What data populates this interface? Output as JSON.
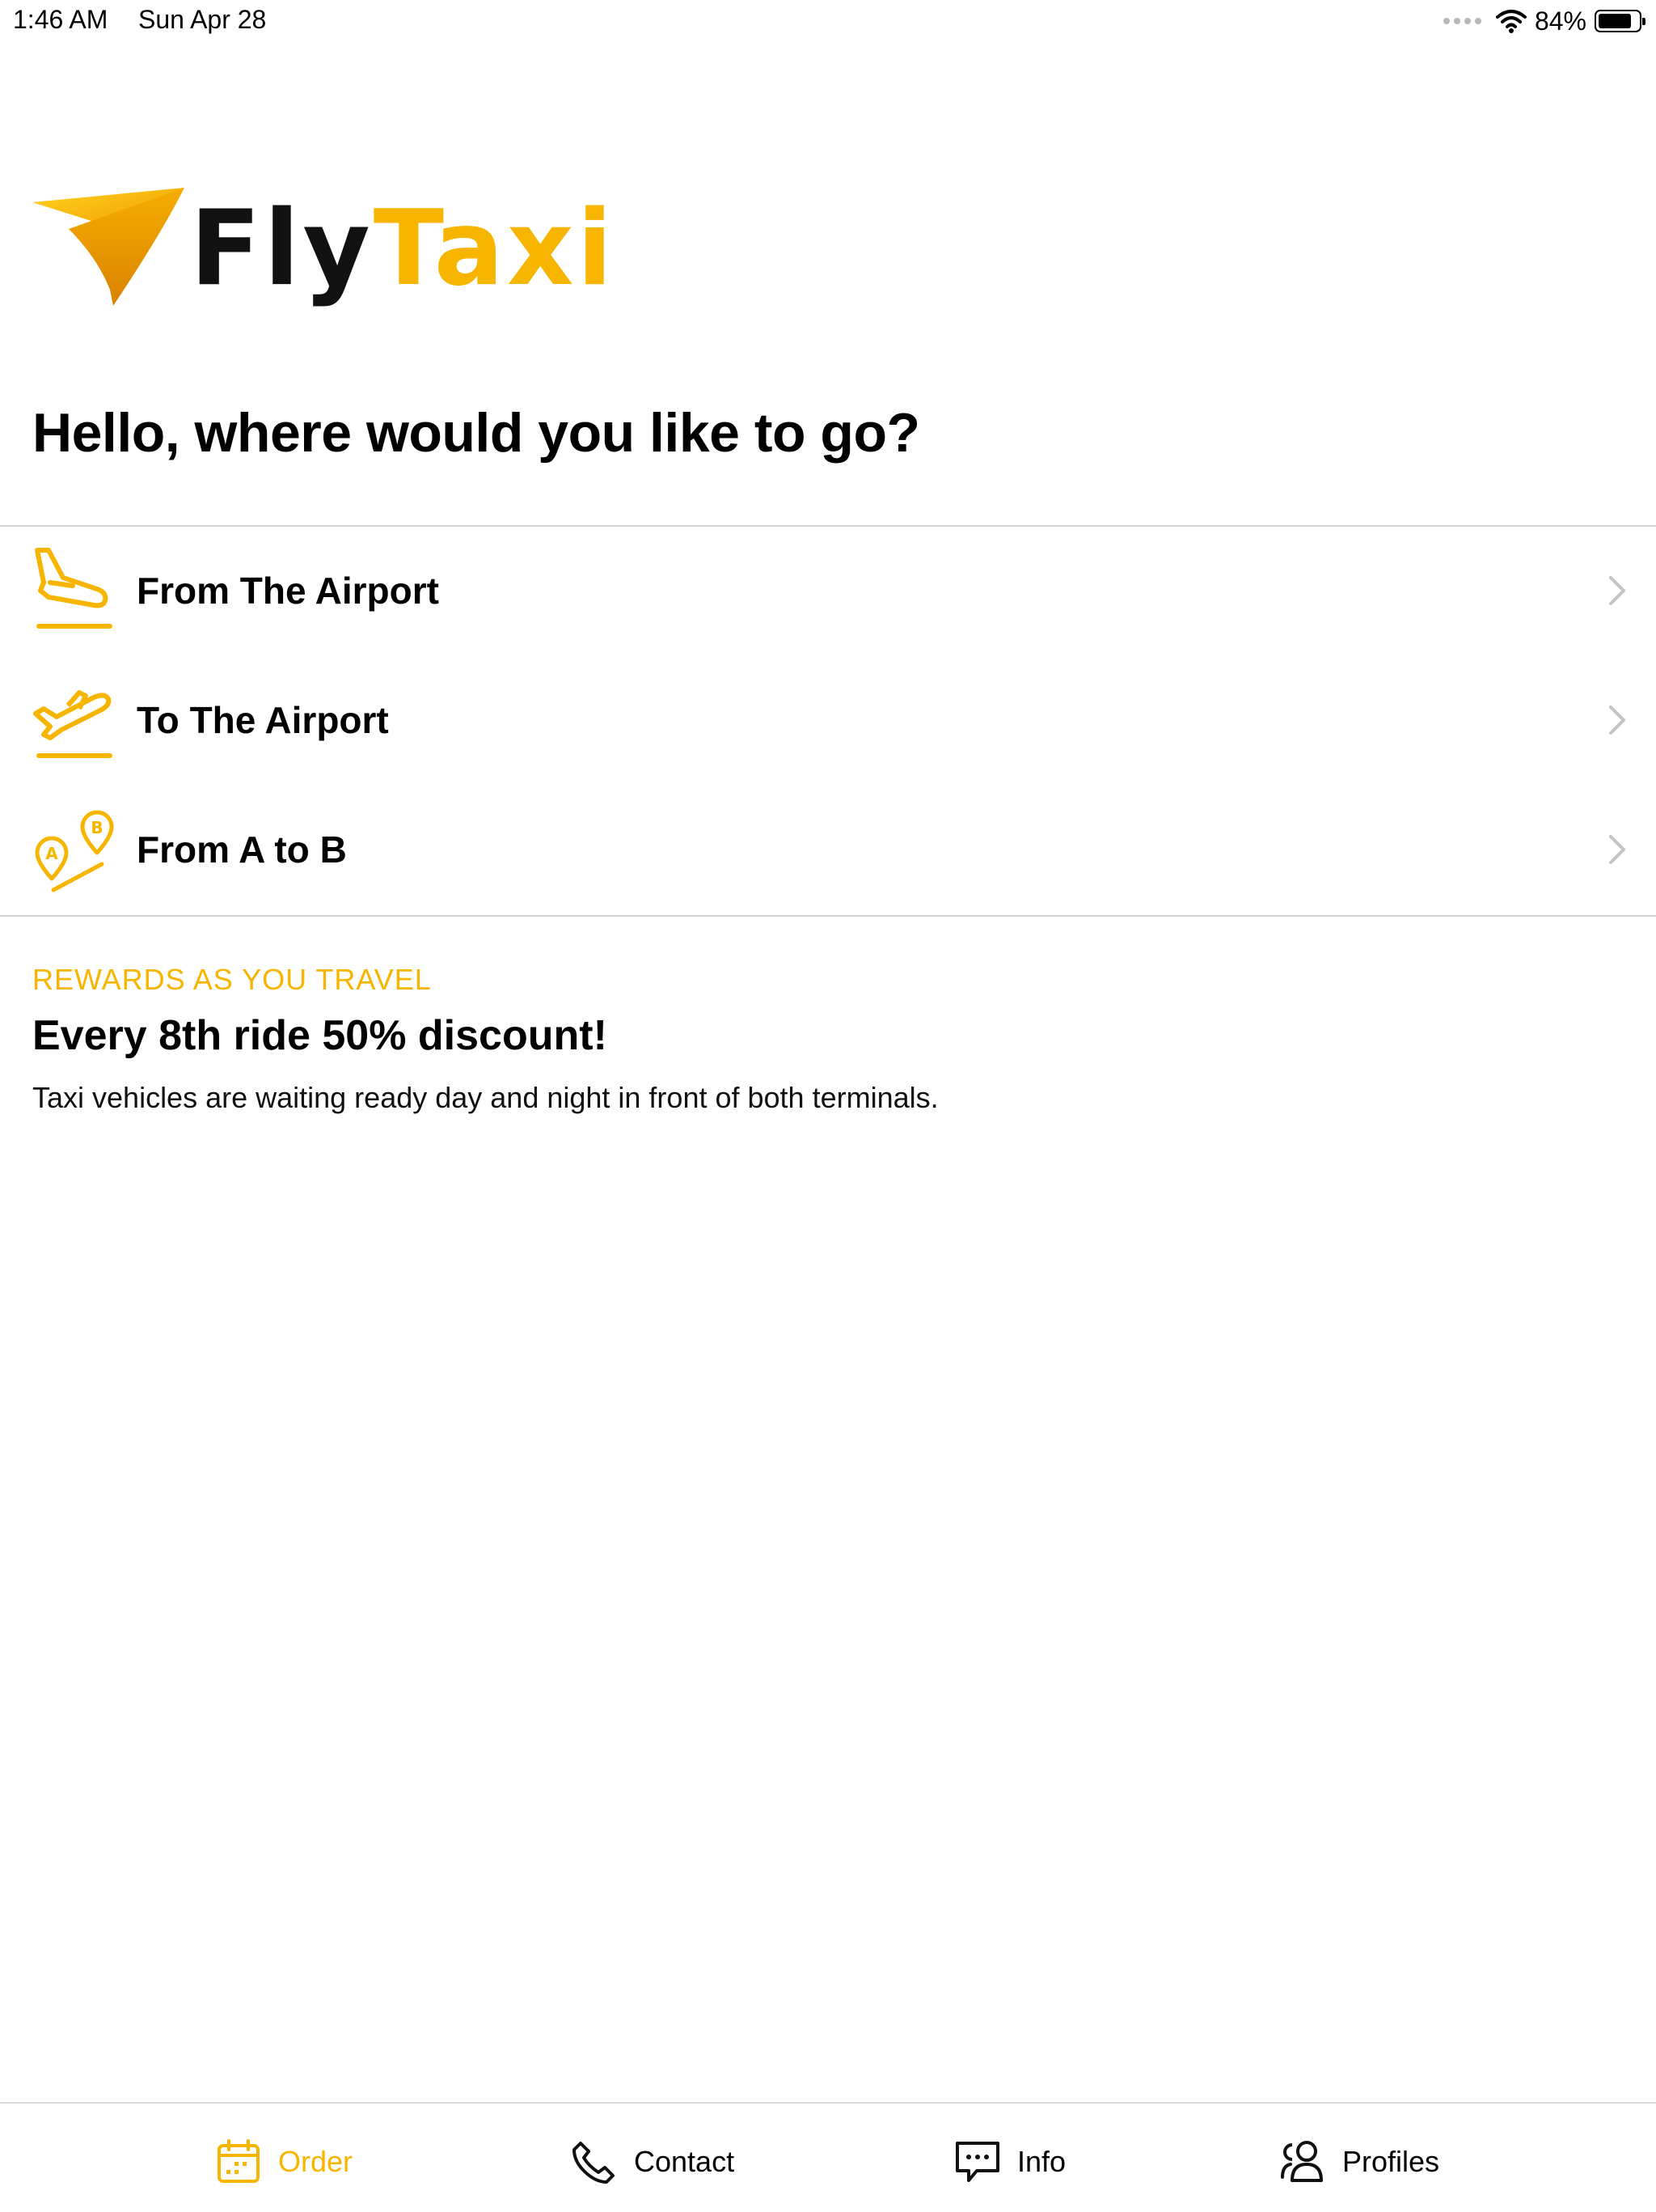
{
  "status_bar": {
    "time": "1:46 AM",
    "date": "Sun Apr 28",
    "battery": "84%",
    "battery_level": 0.84
  },
  "brand": {
    "name_part1": "Fly",
    "name_part2": "Taxi",
    "accent": "#f7b500"
  },
  "greeting": "Hello, where would you like to go?",
  "menu": [
    {
      "label": "From The Airport",
      "icon": "plane-landing-icon"
    },
    {
      "label": "To The Airport",
      "icon": "plane-takeoff-icon"
    },
    {
      "label": "From A to B",
      "icon": "route-pins-icon"
    }
  ],
  "rewards": {
    "eyebrow": "REWARDS AS YOU TRAVEL",
    "title": "Every 8th ride 50% discount!",
    "body": "Taxi vehicles are waiting ready day and night in front of both terminals."
  },
  "tabs": [
    {
      "label": "Order",
      "icon": "calendar-icon",
      "active": true
    },
    {
      "label": "Contact",
      "icon": "phone-icon",
      "active": false
    },
    {
      "label": "Info",
      "icon": "chat-icon",
      "active": false
    },
    {
      "label": "Profiles",
      "icon": "users-icon",
      "active": false
    }
  ]
}
